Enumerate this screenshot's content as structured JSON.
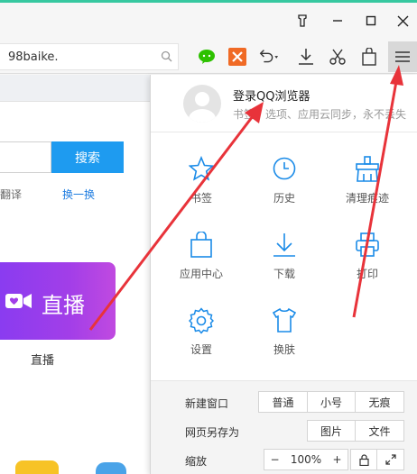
{
  "address": {
    "text": "98baike."
  },
  "login": {
    "title": "登录QQ浏览器",
    "subtitle": "书签、选项、应用云同步，永不丢失"
  },
  "grid": [
    {
      "label": "书签",
      "icon": "star-icon"
    },
    {
      "label": "历史",
      "icon": "clock-icon"
    },
    {
      "label": "清理痕迹",
      "icon": "broom-icon"
    },
    {
      "label": "应用中心",
      "icon": "bag-icon"
    },
    {
      "label": "下载",
      "icon": "download-icon"
    },
    {
      "label": "打印",
      "icon": "printer-icon"
    },
    {
      "label": "设置",
      "icon": "gear-icon"
    },
    {
      "label": "换肤",
      "icon": "tshirt-icon"
    }
  ],
  "options": {
    "new_window": {
      "label": "新建窗口",
      "buttons": [
        "普通",
        "小号",
        "无痕"
      ]
    },
    "save_page": {
      "label": "网页另存为",
      "buttons": [
        "图片",
        "文件"
      ]
    },
    "zoom": {
      "label": "缩放",
      "minus": "−",
      "value": "100%",
      "plus": "+"
    }
  },
  "page": {
    "search_button": "搜索",
    "link_left": "翻译",
    "link_right": "换一换",
    "live_card_text": "直播",
    "live_label": "直播"
  },
  "colors": {
    "accent_line": "#37c8a0",
    "search_button": "#1e9bf0",
    "annotation_arrow": "#e8333a"
  }
}
